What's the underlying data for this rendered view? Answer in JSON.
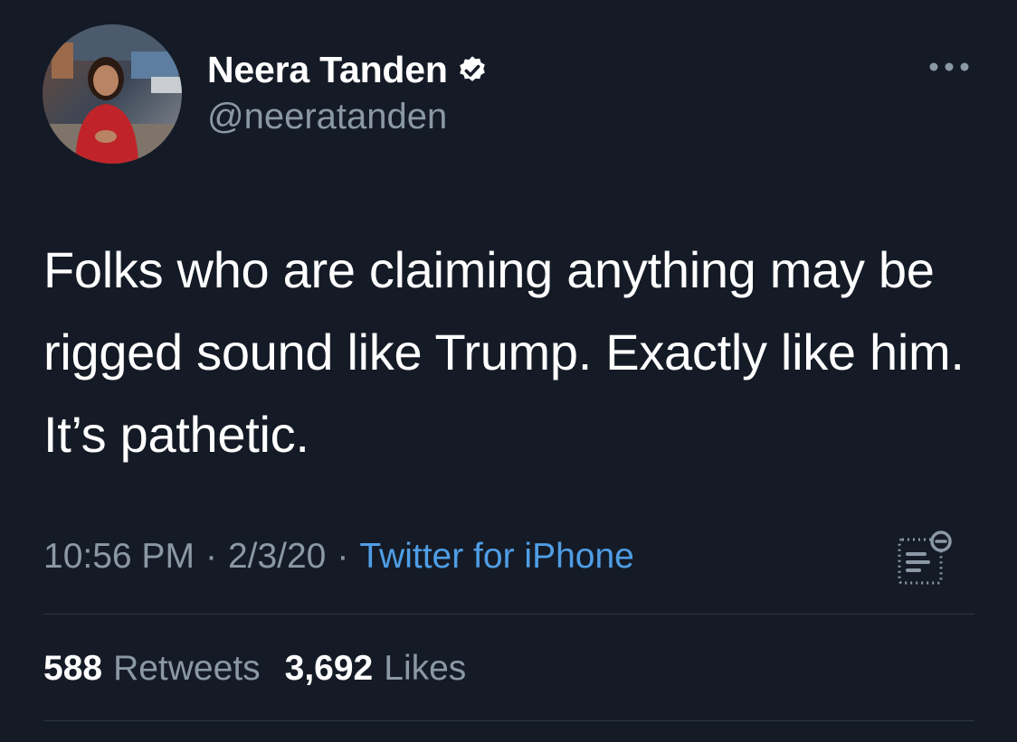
{
  "tweet": {
    "author": {
      "display_name": "Neera Tanden",
      "handle": "@neeratanden",
      "verified": true,
      "avatar_icon": "profile-photo"
    },
    "text": "Folks who are claiming anything may be rigged sound like Trump. Exactly like him. It’s pathetic.",
    "time": "10:56 PM",
    "separator": "·",
    "date": "2/3/20",
    "source": "Twitter for iPhone",
    "stats": {
      "retweets_count": "588",
      "retweets_label": "Retweets",
      "likes_count": "3,692",
      "likes_label": "Likes"
    }
  },
  "icons": {
    "more": "more-options-icon",
    "verified": "verified-badge-icon",
    "analytics": "tweet-analytics-icon"
  },
  "colors": {
    "background": "#151b26",
    "text_primary": "#ffffff",
    "text_secondary": "#8b98a5",
    "link": "#4f9ee6",
    "verified_badge": "#ffffff",
    "divider": "#2f3743"
  }
}
